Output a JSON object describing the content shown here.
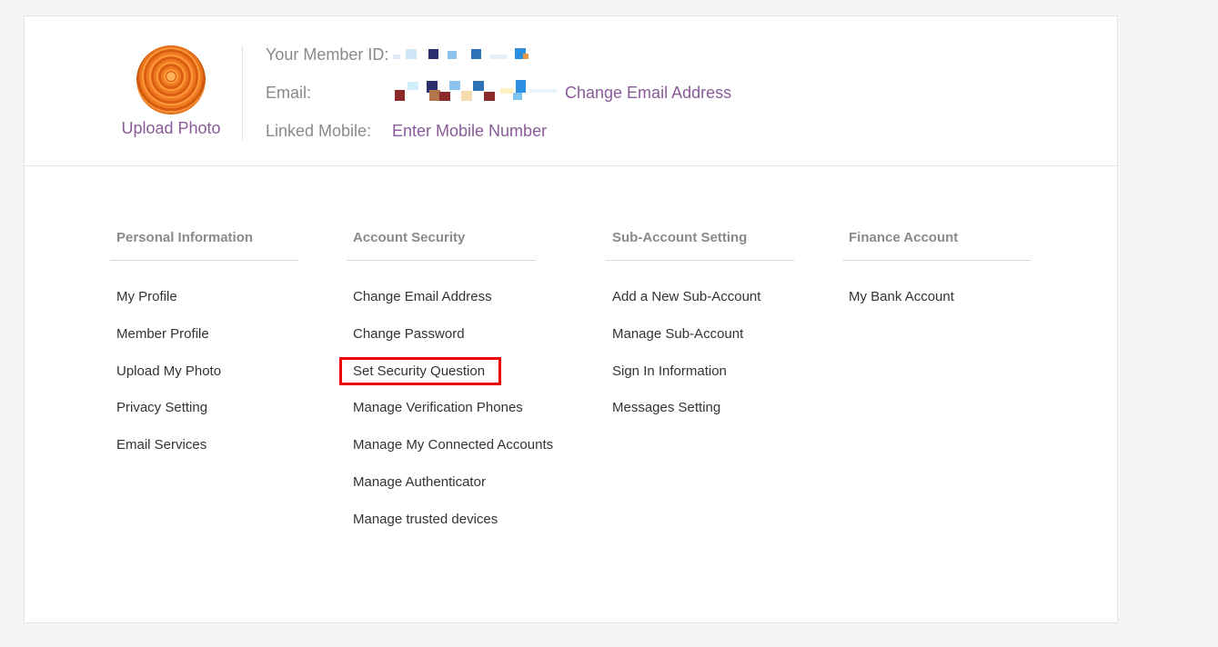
{
  "header": {
    "upload_photo": "Upload Photo",
    "member_id_label": "Your Member ID:",
    "email_label": "Email:",
    "change_email_link": "Change Email Address",
    "mobile_label": "Linked Mobile:",
    "enter_mobile_link": "Enter Mobile Number"
  },
  "columns": [
    {
      "title": "Personal Information",
      "items": [
        "My Profile",
        "Member Profile",
        "Upload My Photo",
        "Privacy Setting",
        "Email Services"
      ]
    },
    {
      "title": "Account Security",
      "items": [
        "Change Email Address",
        "Change Password",
        "Set Security Question",
        "Manage Verification Phones",
        "Manage My Connected Accounts",
        "Manage Authenticator",
        "Manage trusted devices"
      ]
    },
    {
      "title": "Sub-Account Setting",
      "items": [
        "Add a New Sub-Account",
        "Manage Sub-Account",
        "Sign In Information",
        "Messages Setting"
      ]
    },
    {
      "title": "Finance Account",
      "items": [
        "My Bank Account"
      ]
    }
  ],
  "highlighted_item": "Set Security Question",
  "colors": {
    "link": "#8a5a9a",
    "label": "#8a8a8a",
    "highlight": "#ee0000"
  }
}
